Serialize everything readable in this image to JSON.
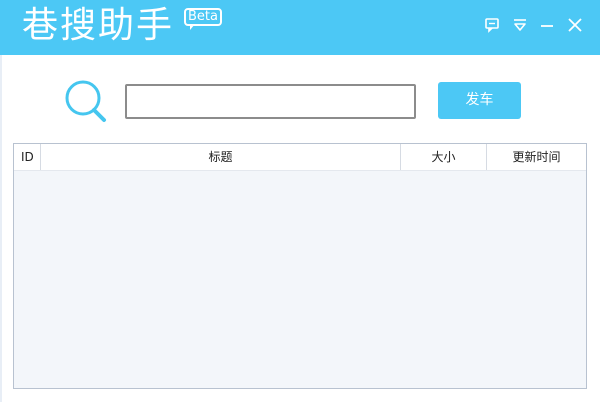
{
  "window": {
    "title": "巷搜助手",
    "badge": "Beta",
    "accent_color": "#4cc8f5"
  },
  "window_controls": [
    {
      "icon": "feedback-icon"
    },
    {
      "icon": "menu-dropdown-icon"
    },
    {
      "icon": "minimize-icon"
    },
    {
      "icon": "close-icon"
    }
  ],
  "search": {
    "icon": "search-icon",
    "value": "",
    "placeholder": "",
    "button_label": "发车"
  },
  "table": {
    "columns": [
      "ID",
      "标题",
      "大小",
      "更新时间"
    ],
    "rows": []
  }
}
